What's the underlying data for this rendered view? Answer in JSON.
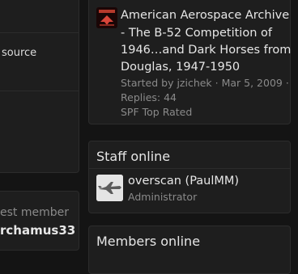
{
  "left": {
    "partial_link_text": "source",
    "latest_member_label": "est member",
    "latest_member_name": "rchamus33"
  },
  "thread": {
    "title_lines": [
      "American Aerospace Archive",
      "- The B-52 Competition of",
      "1946…and Dark Horses from",
      "Douglas, 1947-1950"
    ],
    "meta_line1": "Started by jzichek · Mar 5, 2009 ·",
    "meta_line2": "Replies: 44",
    "meta_line3": "SPF Top Rated"
  },
  "staff": {
    "header": "Staff online",
    "user_name": "overscan (PaulMM)",
    "user_role": "Administrator"
  },
  "members": {
    "header": "Members online"
  }
}
